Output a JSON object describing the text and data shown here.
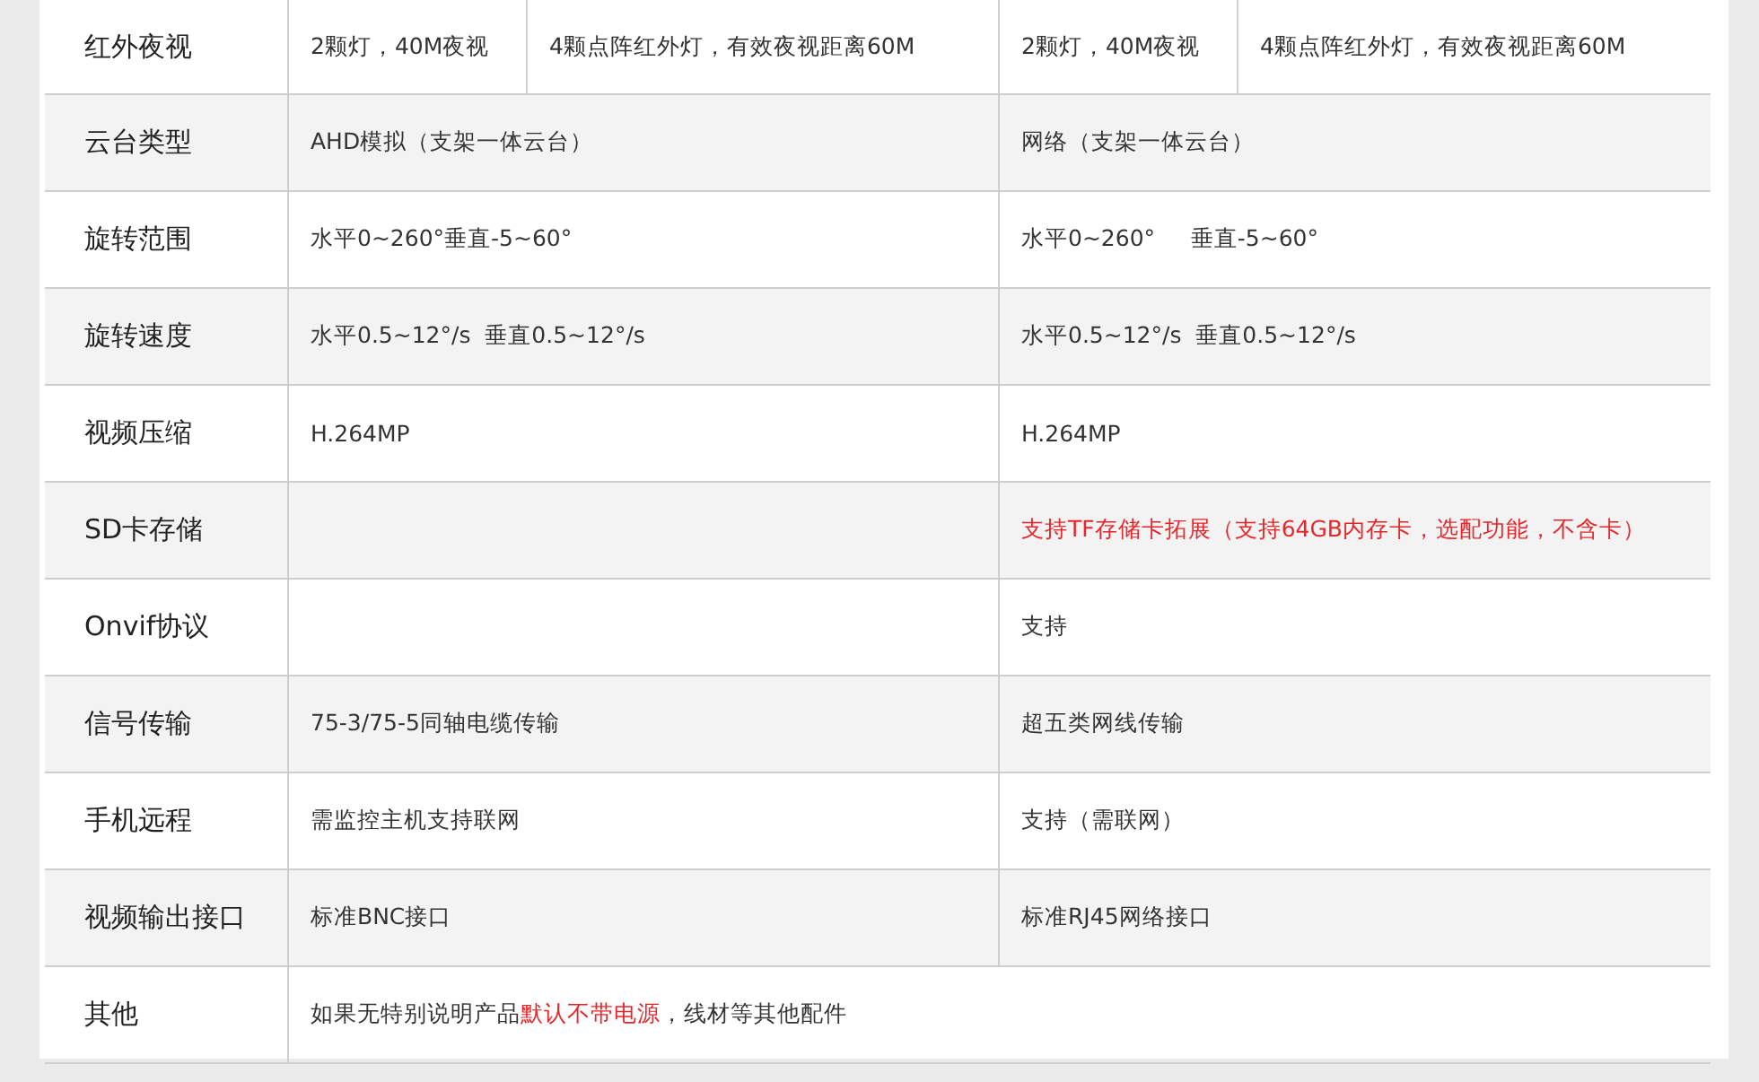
{
  "rows": [
    {
      "label": "红外夜视",
      "kind": "split",
      "cells": [
        {
          "segments": [
            {
              "text": "2颗灯，40M夜视",
              "highlight": false
            }
          ]
        },
        {
          "segments": [
            {
              "text": "4颗点阵红外灯，有效夜视距离60M",
              "highlight": false
            }
          ]
        },
        {
          "segments": [
            {
              "text": "2颗灯，40M夜视",
              "highlight": false
            }
          ]
        },
        {
          "segments": [
            {
              "text": "4颗点阵红外灯，有效夜视距离60M",
              "highlight": false
            }
          ]
        }
      ]
    },
    {
      "label": "云台类型",
      "kind": "pair",
      "cells": [
        {
          "segments": [
            {
              "text": "AHD模拟（支架一体云台）",
              "highlight": false
            }
          ]
        },
        {
          "segments": [
            {
              "text": "网络（支架一体云台）",
              "highlight": false
            }
          ]
        }
      ]
    },
    {
      "label": "旋转范围",
      "kind": "pair",
      "cells": [
        {
          "segments": [
            {
              "text": "水平0~260°垂直-5~60°",
              "highlight": false
            }
          ]
        },
        {
          "segments": [
            {
              "text": "水平0~260°     垂直-5~60°",
              "highlight": false
            }
          ]
        }
      ]
    },
    {
      "label": "旋转速度",
      "kind": "pair",
      "cells": [
        {
          "segments": [
            {
              "text": "水平0.5~12°/s  垂直0.5~12°/s",
              "highlight": false
            }
          ]
        },
        {
          "segments": [
            {
              "text": "水平0.5~12°/s  垂直0.5~12°/s",
              "highlight": false
            }
          ]
        }
      ]
    },
    {
      "label": "视频压缩",
      "kind": "pair",
      "cells": [
        {
          "segments": [
            {
              "text": "H.264MP",
              "highlight": false
            }
          ]
        },
        {
          "segments": [
            {
              "text": "H.264MP",
              "highlight": false
            }
          ]
        }
      ]
    },
    {
      "label": "SD卡存储",
      "kind": "pair",
      "cells": [
        {},
        {
          "segments": [
            {
              "text": "支持TF存储卡拓展（支持64GB内存卡，选配功能，不含卡）",
              "highlight": true
            }
          ]
        }
      ]
    },
    {
      "label": "Onvif协议",
      "kind": "pair",
      "cells": [
        {},
        {
          "segments": [
            {
              "text": "支持",
              "highlight": false
            }
          ]
        }
      ]
    },
    {
      "label": "信号传输",
      "kind": "pair",
      "cells": [
        {
          "segments": [
            {
              "text": "75-3/75-5同轴电缆传输",
              "highlight": false
            }
          ]
        },
        {
          "segments": [
            {
              "text": "超五类网线传输",
              "highlight": false
            }
          ]
        }
      ]
    },
    {
      "label": "手机远程",
      "kind": "pair",
      "cells": [
        {
          "segments": [
            {
              "text": "需监控主机支持联网",
              "highlight": false
            }
          ]
        },
        {
          "segments": [
            {
              "text": "支持（需联网）",
              "highlight": false
            }
          ]
        }
      ]
    },
    {
      "label": "视频输出接口",
      "kind": "pair",
      "cells": [
        {
          "segments": [
            {
              "text": "标准BNC接口",
              "highlight": false
            }
          ]
        },
        {
          "segments": [
            {
              "text": "标准RJ45网络接口",
              "highlight": false
            }
          ]
        }
      ]
    },
    {
      "label": "其他",
      "kind": "full",
      "cells": [
        {
          "segments": [
            {
              "text": "如果无特别说明产品",
              "highlight": false
            },
            {
              "text": "默认不带电源",
              "highlight": true
            },
            {
              "text": "，线材等其他配件",
              "highlight": false
            }
          ]
        }
      ]
    }
  ]
}
